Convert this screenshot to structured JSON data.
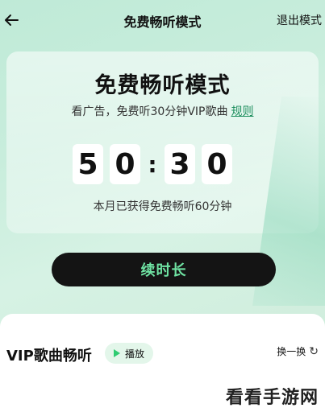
{
  "header": {
    "title": "免费畅听模式",
    "exit_label": "退出模式",
    "back_icon": "arrow-left-icon"
  },
  "card": {
    "title": "免费畅听模式",
    "subtitle": "看广告，免费听30分钟VIP歌曲",
    "rules_link": "规则",
    "timer": {
      "d1": "5",
      "d2": "0",
      "sep": ":",
      "d3": "3",
      "d4": "0"
    },
    "earned_text": "本月已获得免费畅听60分钟"
  },
  "actions": {
    "extend_label": "续时长",
    "extend_color": "#6fe3a3"
  },
  "section": {
    "title": "VIP歌曲畅听",
    "play_label": "播放",
    "refresh_label": "换一换",
    "refresh_icon": "refresh-icon"
  },
  "watermark": "看看手游网"
}
